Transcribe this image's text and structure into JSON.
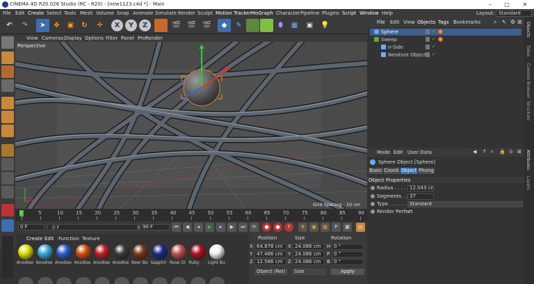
{
  "window": {
    "title": "CINEMA 4D R20.026 Studio (RC - R20) - [new1123.c4d *] - Main",
    "min": "–",
    "max": "□",
    "close": "✕"
  },
  "menu": [
    "File",
    "Edit",
    "Create",
    "Select",
    "Tools",
    "Mesh",
    "Volume",
    "Snap",
    "Animate",
    "Simulate",
    "Render",
    "Sculpt",
    "Motion Tracker",
    "MoGraph",
    "Character",
    "Pipeline",
    "Plugins",
    "Script",
    "Window",
    "Help"
  ],
  "layout": {
    "label": "Layout:",
    "value": "Standard"
  },
  "toolbar_axes": [
    "X",
    "Y",
    "Z"
  ],
  "viewport": {
    "menu": [
      "View",
      "Cameras",
      "Display",
      "Options",
      "Filter",
      "Panel",
      "ProRender"
    ],
    "label": "Perspective",
    "grid_spacing": "Grid Spacing : 10 cm"
  },
  "timeline": {
    "ticks": [
      "0",
      "5",
      "10",
      "15",
      "20",
      "25",
      "30",
      "35",
      "40",
      "45",
      "50",
      "55",
      "60",
      "65",
      "70",
      "75",
      "80",
      "85",
      "90"
    ],
    "frame_current": "0 F",
    "frame_start": "0 F",
    "frame_end_field": "90 F",
    "frame_end": "90 F"
  },
  "materials": {
    "menu": [
      "Create",
      "Edit",
      "Function",
      "Texture"
    ],
    "items": [
      {
        "name": "Anodise",
        "color": "#d8e000"
      },
      {
        "name": "Anodise",
        "color": "#3aa8d8"
      },
      {
        "name": "Anodise",
        "color": "#2a5fd0"
      },
      {
        "name": "Anodise",
        "color": "#d05010"
      },
      {
        "name": "Anodise",
        "color": "#c02020"
      },
      {
        "name": "Anodise",
        "color": "#3a3a3a"
      },
      {
        "name": "Beer Bo",
        "color": "#7a3a18"
      },
      {
        "name": "Sapphir",
        "color": "#1a2a8a"
      },
      {
        "name": "Rose Gl",
        "color": "#c05050"
      },
      {
        "name": "Ruby",
        "color": "#b01020"
      },
      {
        "name": "Light Bu",
        "color": "#f2f2f2"
      }
    ]
  },
  "coords": {
    "headers": [
      "Position",
      "Size",
      "Rotation"
    ],
    "rows": [
      {
        "axis": "X",
        "pos": "64.878 cm",
        "size_axis": "X",
        "size": "24.086 cm",
        "rot_axis": "H",
        "rot": "0 °"
      },
      {
        "axis": "Y",
        "pos": "47.466 cm",
        "size_axis": "Y",
        "size": "24.086 cm",
        "rot_axis": "P",
        "rot": "0 °"
      },
      {
        "axis": "Z",
        "pos": "12.586 cm",
        "size_axis": "Z",
        "size": "24.086 cm",
        "rot_axis": "B",
        "rot": "0 °"
      }
    ],
    "mode": "Object (Rel)",
    "size_mode": "Size",
    "apply": "Apply"
  },
  "objects": {
    "menu": [
      "File",
      "Edit",
      "View",
      "Objects",
      "Tags",
      "Bookmarks"
    ],
    "items": [
      {
        "name": "Sphere",
        "level": 0,
        "selected": true
      },
      {
        "name": "Sweep",
        "level": 0,
        "selected": false
      },
      {
        "name": "n-Side",
        "level": 1,
        "selected": false
      },
      {
        "name": "NeoKnot Object",
        "level": 1,
        "selected": false
      }
    ]
  },
  "attributes": {
    "menu": [
      "Mode",
      "Edit",
      "User Data"
    ],
    "object_title": "Sphere Object [Sphere]",
    "tabs": [
      "Basic",
      "Coord.",
      "Object",
      "Phong"
    ],
    "active_tab": "Object",
    "section": "Object Properties",
    "radius_label": "Radius . . . . . .",
    "radius": "12.043 cm",
    "segments_label": "Segments . . . .",
    "segments": "37",
    "type_label": "Type . . . . . . . .",
    "type": "Standard",
    "render_perfect_label": "Render Perfect",
    "render_perfect": "✓"
  },
  "right_tabs": [
    "Objects",
    "Takes",
    "Content Browser",
    "Structure",
    "Attributes",
    "Layers"
  ],
  "colors": {
    "accent": "#3d6fb0",
    "orange": "#ff9a1f"
  }
}
